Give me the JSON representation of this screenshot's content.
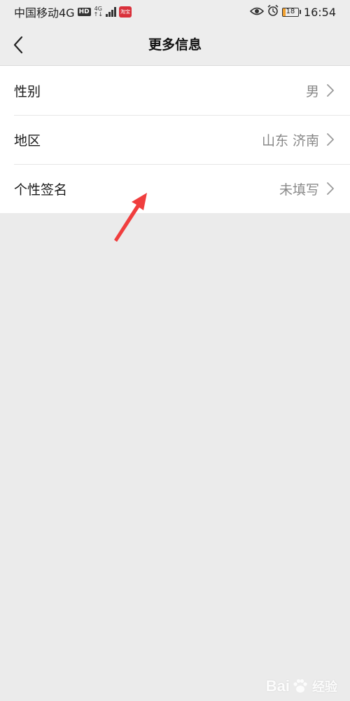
{
  "status_bar": {
    "carrier": "中国移动4G",
    "hd_badge": "HD",
    "network_badge_top": "4G",
    "network_badge_bottom": "↑↓",
    "app_badge": "淘宝",
    "battery": "18",
    "battery_level_percent": 18,
    "time": "16:54"
  },
  "nav": {
    "title": "更多信息"
  },
  "info_rows": [
    {
      "label": "性别",
      "value": "男"
    },
    {
      "label": "地区",
      "value": "山东 济南"
    },
    {
      "label": "个性签名",
      "value": "未填写"
    }
  ],
  "watermark": {
    "brand_left": "Bai",
    "brand_right": "经验"
  },
  "colors": {
    "background": "#ebebeb",
    "list_background": "#ffffff",
    "value_text": "#888888",
    "arrow": "#f03e3e",
    "battery_fill": "#f0a030"
  },
  "icons": {
    "back": "chevron-left-icon",
    "row_arrow": "chevron-right-icon",
    "eye": "eye-icon",
    "alarm": "alarm-clock-icon",
    "signal": "signal-bars-icon",
    "annotation": "red-arrow-icon"
  }
}
